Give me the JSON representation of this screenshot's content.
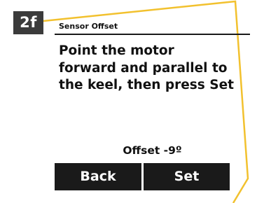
{
  "step": {
    "label": "2f"
  },
  "screen": {
    "title": "Sensor Offset",
    "instruction": "Point the motor forward and parallel to the keel, then press Set",
    "offset_readout": "Offset -9º"
  },
  "buttons": {
    "back_label": "Back",
    "set_label": "Set"
  },
  "colors": {
    "frame_accent": "#f2c12e",
    "badge_background": "#3b3b3b",
    "button_background": "#1a1a1a",
    "text": "#111111"
  }
}
